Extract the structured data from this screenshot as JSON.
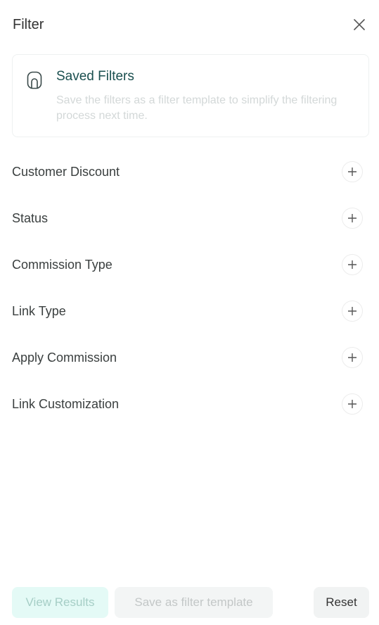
{
  "header": {
    "title": "Filter",
    "close_icon": "close-icon"
  },
  "saved_filters": {
    "icon": "saved-filter-icon",
    "title": "Saved Filters",
    "description": "Save the filters as a filter template to simplify the filtering process next time."
  },
  "filters": [
    {
      "label": "Customer Discount",
      "icon": "plus-icon"
    },
    {
      "label": "Status",
      "icon": "plus-icon"
    },
    {
      "label": "Commission Type",
      "icon": "plus-icon"
    },
    {
      "label": "Link Type",
      "icon": "plus-icon"
    },
    {
      "label": "Apply Commission",
      "icon": "plus-icon"
    },
    {
      "label": "Link Customization",
      "icon": "plus-icon"
    }
  ],
  "footer": {
    "view_results_label": "View Results",
    "save_template_label": "Save as filter template",
    "reset_label": "Reset"
  },
  "colors": {
    "accent": "#1a4f4f",
    "view_results_bg": "#e4faf6",
    "disabled_text": "#c3c7c7"
  }
}
